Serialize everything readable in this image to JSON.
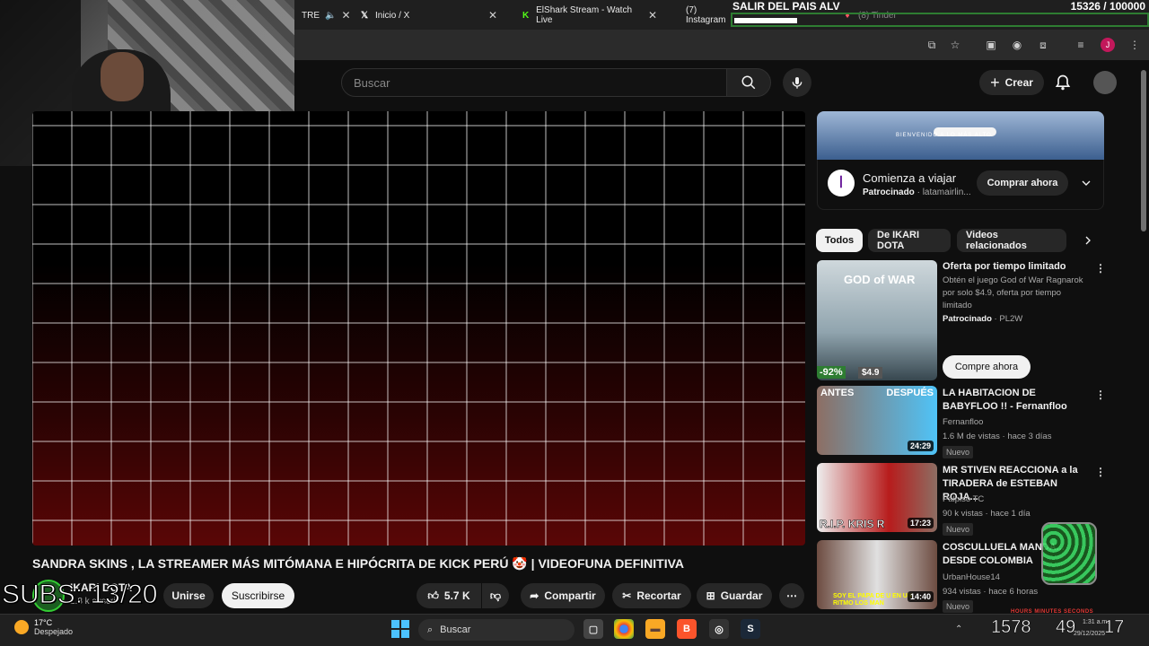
{
  "browser": {
    "tabs": [
      {
        "label": "TRE",
        "muted_icon": "speaker-icon"
      },
      {
        "label": "Inicio / X"
      },
      {
        "label": "ElShark Stream - Watch Live"
      },
      {
        "label": "(7) Instagram"
      },
      {
        "label": "(8) Tinder"
      }
    ]
  },
  "goal_overlay": {
    "title": "SALIR DEL PAIS ALV",
    "count": "15326 / 100000",
    "progress": 0.153
  },
  "header": {
    "search_placeholder": "Buscar",
    "create_label": "Crear"
  },
  "video": {
    "title": "SANDRA SKINS , LA STREAMER MÁS MITÓMANA E HIPÓCRITA DE KICK PERÚ 🤡 | VIDEOFUNA DEFINITIVA",
    "channel": "IKARI DOTA",
    "subs": "2.8 k suscri",
    "join_label": "Unirse",
    "subscribe_label": "Suscribirse",
    "likes": "5.7 K",
    "share_label": "Compartir",
    "clip_label": "Recortar",
    "save_label": "Guardar"
  },
  "subs_overlay": "SUBS: 13/20",
  "ad": {
    "banner_text": "BIENVENIDO A LO MÁS ALTO",
    "title": "Comienza a viajar",
    "sponsored": "Patrocinado",
    "advertiser": "latamairlin...",
    "cta": "Comprar ahora"
  },
  "chips": [
    "Todos",
    "De IKARI DOTA",
    "Videos relacionados"
  ],
  "sidebar_videos": [
    {
      "title": "Oferta por tiempo limitado",
      "desc": "Obtén el juego God of War Ragnarok por solo $4.9, oferta por tiempo limitado",
      "sponsored": "Patrocinado",
      "advertiser": "PL2W",
      "cta": "Compre ahora",
      "discount": "-92%",
      "price": "$4.9",
      "thumb_logo": "GOD of WAR"
    },
    {
      "title": "LA HABITACION DE BABYFLOO !! - Fernanfloo",
      "channel": "Fernanfloo",
      "meta": "1.6 M de vistas · hace 3 días",
      "badge": "Nuevo",
      "duration": "24:29",
      "thumb_text_left": "ANTES",
      "thumb_text_right": "DESPUÉS"
    },
    {
      "title": "MR STIVEN REACCIONA a la TIRADERA de ESTEBAN ROJA...",
      "channel": "Palpiso TC",
      "meta": "90 k vistas · hace 1 día",
      "badge": "Nuevo",
      "duration": "17:23",
      "thumb_text": "R.I.P. KRIS R"
    },
    {
      "title": "COSCULLUELA MANDA... DESDE COLOMBIA",
      "channel": "UrbanHouse14",
      "meta": "934 vistas · hace 6 horas",
      "badge": "Nuevo",
      "duration": "14:40",
      "thumb_text": "SOY EL PAPA DE U EN UN RITMO LOS MAN"
    }
  ],
  "taskbar": {
    "temp": "17°C",
    "weather": "Despejado",
    "search_label": "Buscar",
    "tray_big_1": "1578",
    "tray_big_2": "49",
    "tray_big_3": "17",
    "time": "1:31 a.m.",
    "date": "29/12/2025",
    "hms_labels": "HOURS   MINUTES   SECONDS"
  },
  "colors": {
    "bg": "#0f0f0f",
    "accent_green": "#2e7d32",
    "player_red": "#5a0606"
  }
}
